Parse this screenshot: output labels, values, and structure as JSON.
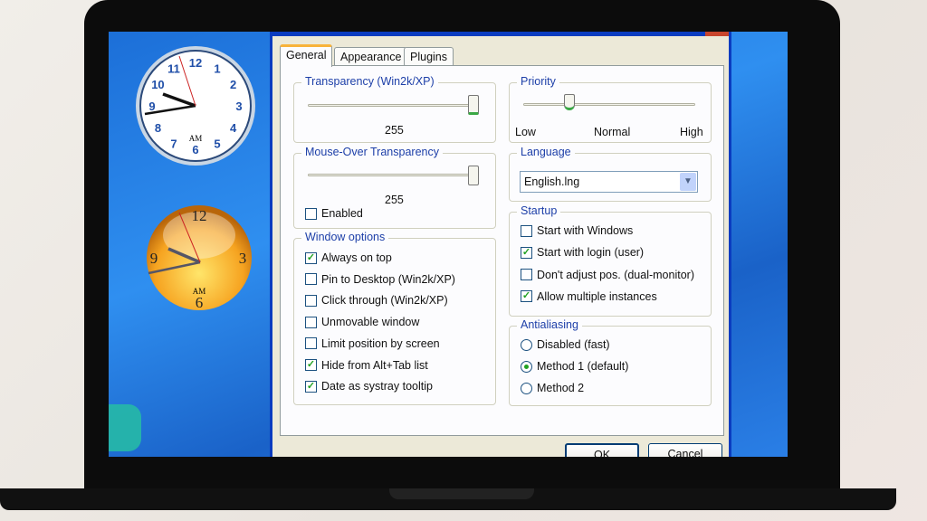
{
  "clocks": [
    {
      "period": "AM",
      "numerals": [
        "12",
        "1",
        "2",
        "3",
        "4",
        "5",
        "6",
        "7",
        "8",
        "9",
        "10",
        "11"
      ]
    },
    {
      "period": "AM",
      "numerals": [
        "12",
        "3",
        "6",
        "9"
      ]
    }
  ],
  "dialog": {
    "tabs": [
      {
        "label": "General",
        "active": true
      },
      {
        "label": "Appearance"
      },
      {
        "label": "Plugins"
      }
    ],
    "transparency": {
      "title": "Transparency (Win2k/XP)",
      "value": "255"
    },
    "mouse_over": {
      "title": "Mouse-Over Transparency",
      "value": "255",
      "enabled_label": "Enabled",
      "enabled": false
    },
    "window_options": {
      "title": "Window options",
      "items": [
        {
          "label": "Always on top",
          "checked": true
        },
        {
          "label": "Pin to Desktop (Win2k/XP)",
          "checked": false
        },
        {
          "label": "Click through (Win2k/XP)",
          "checked": false
        },
        {
          "label": "Unmovable window",
          "checked": false
        },
        {
          "label": "Limit position by screen",
          "checked": false
        },
        {
          "label": "Hide from Alt+Tab list",
          "checked": true
        },
        {
          "label": "Date as systray tooltip",
          "checked": true
        }
      ]
    },
    "priority": {
      "title": "Priority",
      "low": "Low",
      "normal": "Normal",
      "high": "High",
      "level_fraction": 0.27
    },
    "language": {
      "title": "Language",
      "selected": "English.lng"
    },
    "startup": {
      "title": "Startup",
      "items": [
        {
          "label": "Start with Windows",
          "checked": false
        },
        {
          "label": "Start with login (user)",
          "checked": true
        },
        {
          "label": "Don't adjust pos. (dual-monitor)",
          "checked": false
        },
        {
          "label": "Allow multiple instances",
          "checked": true
        }
      ]
    },
    "antialiasing": {
      "title": "Antialiasing",
      "options": [
        {
          "label": "Disabled (fast)",
          "selected": false
        },
        {
          "label": "Method 1 (default)",
          "selected": true
        },
        {
          "label": "Method 2",
          "selected": false
        }
      ]
    },
    "ok_label": "OK",
    "cancel_label": "Cancel"
  },
  "colors": {
    "accent": "#0a3cc0",
    "check": "#21a121",
    "group_title": "#1d3fa8"
  }
}
